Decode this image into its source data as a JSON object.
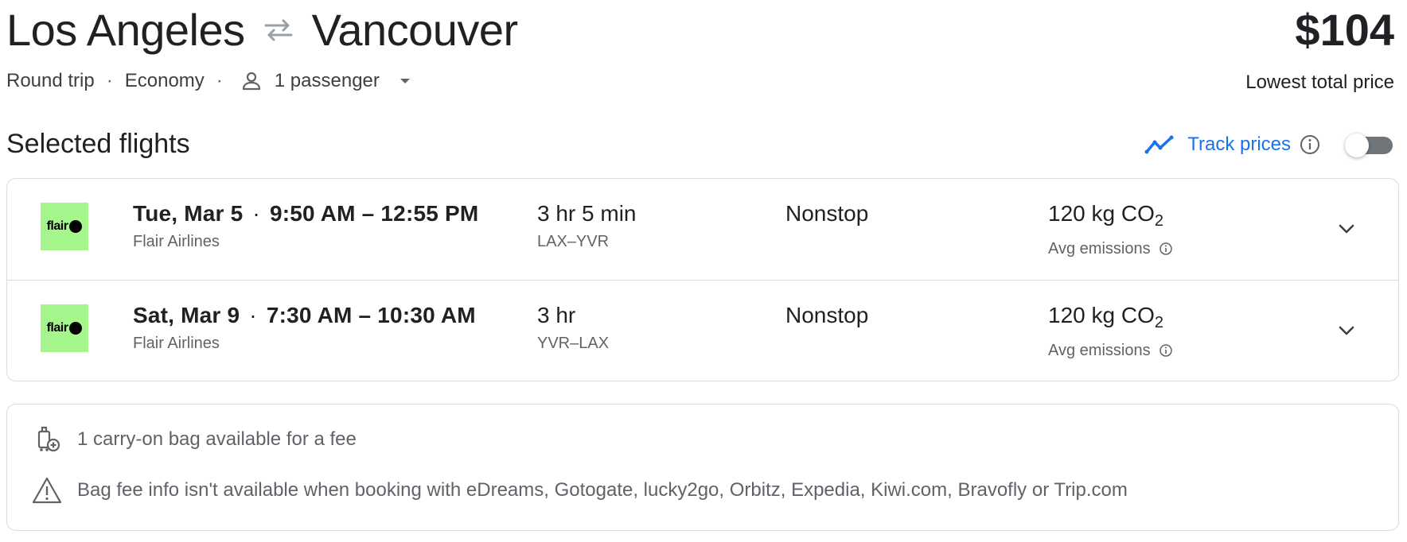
{
  "header": {
    "origin": "Los Angeles",
    "destination": "Vancouver",
    "price": "$104",
    "price_caption": "Lowest total price",
    "trip_type": "Round trip",
    "cabin": "Economy",
    "passengers": "1 passenger"
  },
  "section": {
    "title": "Selected flights",
    "track_label": "Track prices",
    "track_enabled": false
  },
  "flights": [
    {
      "date": "Tue, Mar 5",
      "times": "9:50 AM – 12:55 PM",
      "airline": "Flair Airlines",
      "duration": "3 hr 5 min",
      "route": "LAX–YVR",
      "stops": "Nonstop",
      "emissions_value": "120 kg CO",
      "emissions_sub": "2",
      "emissions_label": "Avg emissions",
      "logo_text": "flair"
    },
    {
      "date": "Sat, Mar 9",
      "times": "7:30 AM – 10:30 AM",
      "airline": "Flair Airlines",
      "duration": "3 hr",
      "route": "YVR–LAX",
      "stops": "Nonstop",
      "emissions_value": "120 kg CO",
      "emissions_sub": "2",
      "emissions_label": "Avg emissions",
      "logo_text": "flair"
    }
  ],
  "bags": {
    "carry_on": "1 carry-on bag available for a fee",
    "fee_info": "Bag fee info isn't available when booking with eDreams, Gotogate, lucky2go, Orbitz, Expedia, Kiwi.com, Bravofly or Trip.com"
  },
  "icons": {
    "swap": "swap-arrows-icon",
    "person": "person-icon",
    "caret": "caret-down-icon",
    "track": "trend-line-icon",
    "info": "info-icon",
    "expand": "chevron-down-icon",
    "luggage": "luggage-add-icon",
    "warning": "warning-icon"
  },
  "colors": {
    "accent": "#1a73e8",
    "airline_logo_bg": "#a5f78d",
    "border": "#dadce0",
    "secondary_text": "#5f6368"
  }
}
